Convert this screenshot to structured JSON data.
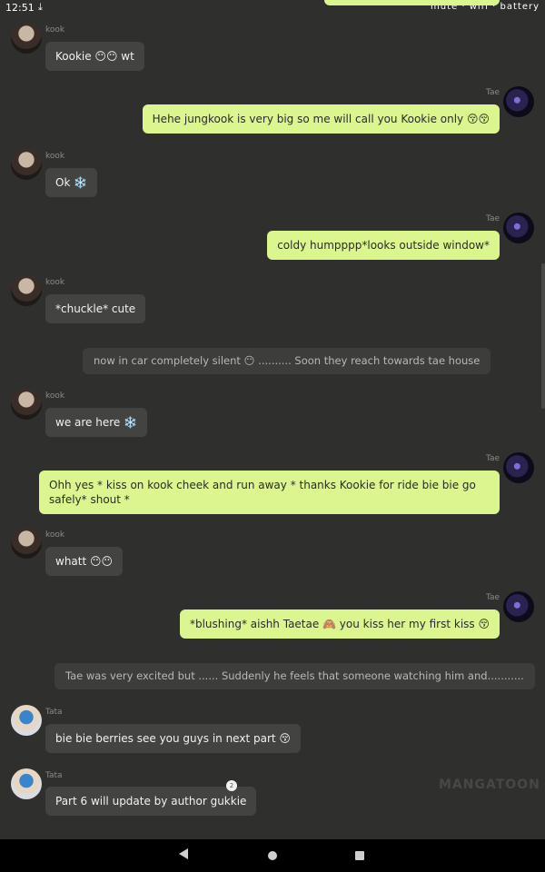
{
  "status": {
    "time": "12:51",
    "download_icon": "download-icon",
    "icons": "mute · wifi · battery"
  },
  "messages": [
    {
      "sender": "kook",
      "text": "Kookie 😶😶 wt"
    },
    {
      "sender": "Tae",
      "text": "Hehe jungkook is very big so me will call you Kookie only 😚😚"
    },
    {
      "sender": "kook",
      "text": "Ok ❄️"
    },
    {
      "sender": "Tae",
      "text": "coldy humpppp*looks outside window*"
    },
    {
      "sender": "kook",
      "text": "*chuckle* cute"
    },
    {
      "narration": "now in car completely silent 😶  .......... Soon they reach towards tae house"
    },
    {
      "sender": "kook",
      "text": "we are here ❄️"
    },
    {
      "sender": "Tae",
      "text": "Ohh yes * kiss on kook cheek and run away * thanks Kookie for ride bie bie go safely* shout *"
    },
    {
      "sender": "kook",
      "text": "whatt 😶😶"
    },
    {
      "sender": "Tae",
      "text": "*blushing* aishh Taetae 🙈 you kiss her my first kiss 😚"
    },
    {
      "narration": "Tae was very excited but ...... Suddenly he feels that someone watching him and..........."
    },
    {
      "sender": "Tata",
      "text": "bie bie berries see you guys in next part 😚"
    },
    {
      "sender": "Tata",
      "text": "Part 6 will update by author gukkie",
      "badge": "2"
    }
  ],
  "watermark": "MANGATOON",
  "nav": {
    "back": "back-icon",
    "home": "home-icon",
    "recents": "recents-icon"
  }
}
